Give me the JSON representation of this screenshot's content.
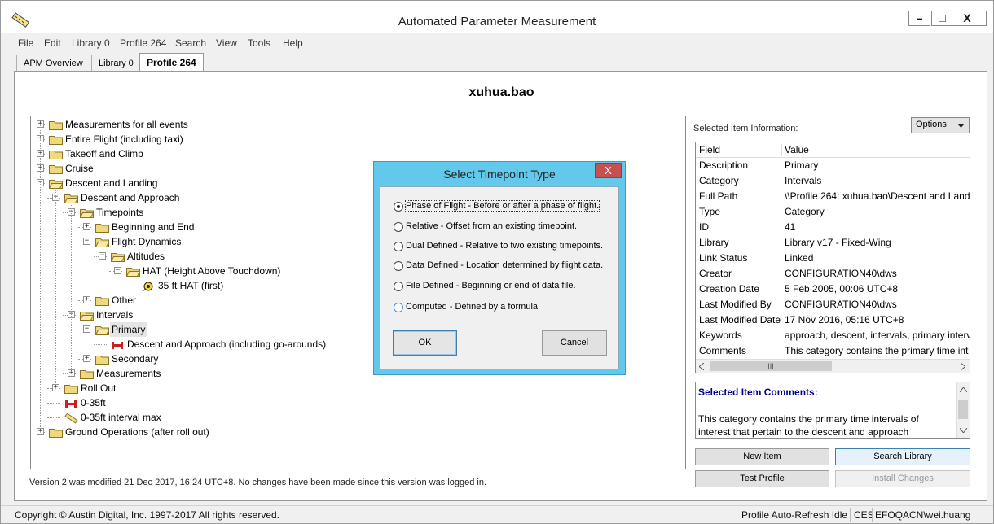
{
  "window": {
    "title": "Automated Parameter Measurement",
    "minimize": "–",
    "maximize": "□",
    "close": "X"
  },
  "menu": [
    "File",
    "Edit",
    "Library 0",
    "Profile 264",
    "Search",
    "View",
    "Tools",
    "Help"
  ],
  "tabs": [
    {
      "label": "APM Overview"
    },
    {
      "label": "Library 0"
    },
    {
      "label": "Profile 264",
      "active": true
    }
  ],
  "profile": {
    "title": "xuhua.bao"
  },
  "tree": {
    "nodes": [
      {
        "label": "Measurements for all events",
        "level": 0,
        "expander": "+",
        "icon": "folder"
      },
      {
        "label": "Entire Flight (including taxi)",
        "level": 0,
        "expander": "+",
        "icon": "folder"
      },
      {
        "label": "Takeoff and Climb",
        "level": 0,
        "expander": "+",
        "icon": "folder"
      },
      {
        "label": "Cruise",
        "level": 0,
        "expander": "+",
        "icon": "folder"
      },
      {
        "label": "Descent and Landing",
        "level": 0,
        "expander": "−",
        "icon": "folder-open"
      },
      {
        "label": "Descent and Approach",
        "level": 1,
        "expander": "−",
        "icon": "folder-open"
      },
      {
        "label": "Timepoints",
        "level": 2,
        "expander": "−",
        "icon": "folder-open"
      },
      {
        "label": "Beginning and End",
        "level": 3,
        "expander": "+",
        "icon": "folder"
      },
      {
        "label": "Flight Dynamics",
        "level": 3,
        "expander": "−",
        "icon": "folder-open"
      },
      {
        "label": "Altitudes",
        "level": 4,
        "expander": "−",
        "icon": "folder-open"
      },
      {
        "label": "HAT (Height Above Touchdown)",
        "level": 5,
        "expander": "−",
        "icon": "folder-open"
      },
      {
        "label": "35 ft HAT (first)",
        "level": 6,
        "expander": "",
        "icon": "timepoint"
      },
      {
        "label": "Other",
        "level": 3,
        "expander": "+",
        "icon": "folder"
      },
      {
        "label": "Intervals",
        "level": 2,
        "expander": "−",
        "icon": "folder-open"
      },
      {
        "label": "Primary",
        "level": 3,
        "expander": "−",
        "icon": "folder-open",
        "selected": true
      },
      {
        "label": "Descent and Approach (including go-arounds)",
        "level": 4,
        "expander": "",
        "icon": "interval"
      },
      {
        "label": "Secondary",
        "level": 3,
        "expander": "+",
        "icon": "folder"
      },
      {
        "label": "Measurements",
        "level": 2,
        "expander": "+",
        "icon": "folder"
      },
      {
        "label": "Roll Out",
        "level": 1,
        "expander": "+",
        "icon": "folder"
      },
      {
        "label": "0-35ft",
        "level": 1,
        "expander": "",
        "icon": "interval"
      },
      {
        "label": "0-35ft interval max",
        "level": 1,
        "expander": "",
        "icon": "measurement"
      },
      {
        "label": "Ground Operations (after roll out)",
        "level": 0,
        "expander": "+",
        "icon": "folder"
      }
    ]
  },
  "version_text": "Version 2 was modified 21 Dec 2017, 16:24 UTC+8. No changes have been made since this version was logged in.",
  "info_panel": {
    "label": "Selected Item Information:",
    "options_button": "Options",
    "columns": {
      "field": "Field",
      "value": "Value"
    },
    "rows": [
      {
        "field": "Description",
        "value": "Primary"
      },
      {
        "field": "Category",
        "value": "Intervals"
      },
      {
        "field": "Full Path",
        "value": "\\\\Profile 264: xuhua.bao\\Descent and Landi"
      },
      {
        "field": "Type",
        "value": "Category"
      },
      {
        "field": "ID",
        "value": "41"
      },
      {
        "field": "Library",
        "value": "Library v17 - Fixed-Wing"
      },
      {
        "field": "Link Status",
        "value": "Linked"
      },
      {
        "field": "Creator",
        "value": "CONFIGURATION40\\dws"
      },
      {
        "field": "Creation Date",
        "value": "5 Feb 2005, 00:06 UTC+8"
      },
      {
        "field": "Last Modified By",
        "value": "CONFIGURATION40\\dws"
      },
      {
        "field": "Last Modified Date",
        "value": "17 Nov 2016, 05:16 UTC+8"
      },
      {
        "field": "Keywords",
        "value": "approach, descent, intervals, primary interv"
      },
      {
        "field": "Comments",
        "value": "This category contains the primary time int"
      }
    ],
    "scroll_thumb": "III"
  },
  "comments": {
    "title": "Selected Item Comments:",
    "text": "This category contains the primary time intervals of interest that pertain to the descent and approach"
  },
  "buttons": {
    "new_item": "New Item",
    "search_library": "Search Library",
    "test_profile": "Test Profile",
    "install_changes": "Install Changes"
  },
  "dialog": {
    "title": "Select Timepoint Type",
    "close": "X",
    "options": [
      {
        "label": "Phase of Flight - Before or after a phase of flight.",
        "selected": true
      },
      {
        "label": "Relative - Offset from an existing timepoint.",
        "selected": false
      },
      {
        "label": "Dual Defined - Relative to two existing timepoints.",
        "selected": false
      },
      {
        "label": "Data Defined - Location determined by flight data.",
        "selected": false
      },
      {
        "label": "File Defined - Beginning or end of data file.",
        "selected": false
      },
      {
        "label": "Computed - Defined by a formula.",
        "selected": false
      }
    ],
    "ok": "OK",
    "cancel": "Cancel"
  },
  "statusbar": {
    "copyright": "Copyright © Austin Digital, Inc. 1997-2017 All rights reserved.",
    "refresh": "Profile Auto-Refresh Idle",
    "ces": "CES",
    "user": "EFOQACN\\wei.huang"
  },
  "colors": {
    "dialog_frame": "#62c9ec",
    "dialog_close": "#c75050",
    "comments_title": "#00008b",
    "folder": "#f0d97a"
  }
}
